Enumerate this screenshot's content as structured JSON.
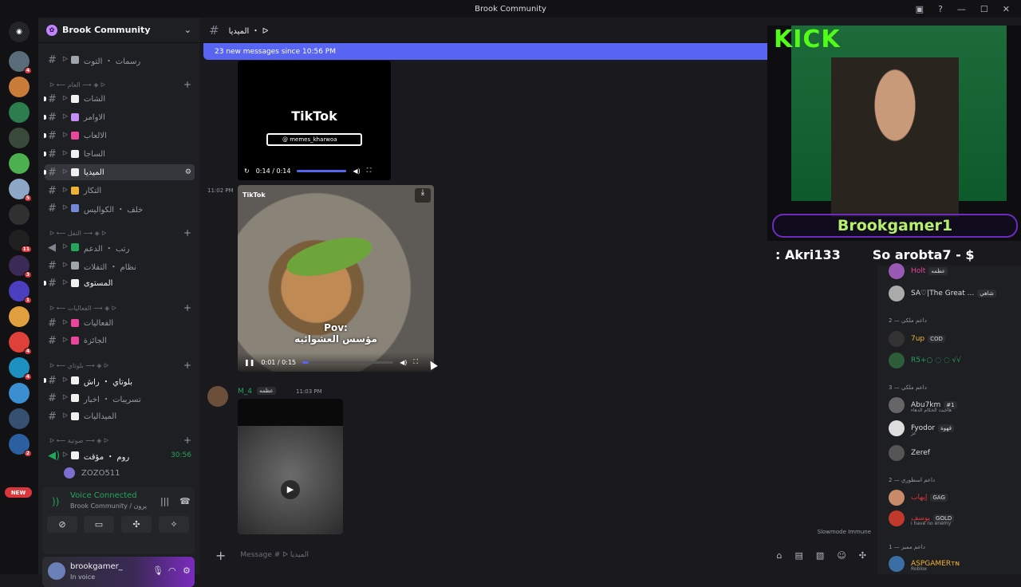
{
  "window": {
    "title": "Brook Community"
  },
  "guild": {
    "name": "Brook Community"
  },
  "categories": [
    {
      "label": "ᐅ ⟵ العام ⟶ ◈ ᐅ"
    },
    {
      "label": "ᐅ ⟵ التفل ⟶ ◈ ᐅ"
    },
    {
      "label": "ᐅ ⟵ الفعاليات ⟶ ◈ ᐅ"
    },
    {
      "label": "ᐅ ⟵ بلوتاي ⟶ ◈ ᐅ"
    },
    {
      "label": "ᐅ ⟵ صوتية ⟶ ◈ ᐅ"
    }
  ],
  "channels": [
    {
      "label": "رسمات ・ التوت",
      "color": "#a0a4ab"
    },
    {
      "label": "الشات",
      "color": "#f0f0f0"
    },
    {
      "label": "الاوامر",
      "color": "#c78ef7"
    },
    {
      "label": "الالعاب",
      "color": "#eb459e"
    },
    {
      "label": "الساجا",
      "color": "#f0f0f0"
    },
    {
      "label": "الميديا",
      "color": "#f0f0f0"
    },
    {
      "label": "التكار",
      "color": "#f0b232"
    },
    {
      "label": "خلف ・ الكواليس",
      "color": "#7289da"
    },
    {
      "label": "رتب ・ الدعم",
      "color": "#23a55a"
    },
    {
      "label": "نظام ・ التفلات",
      "color": "#a0a4ab"
    },
    {
      "label": "المستوى",
      "color": "#f0f0f0"
    },
    {
      "label": "الفعاليات",
      "color": "#eb459e"
    },
    {
      "label": "الجائزة",
      "color": "#eb459e"
    },
    {
      "label": "بلوتاي ・ راش",
      "color": "#f0f0f0"
    },
    {
      "label": "تسريبات ・ اخبار",
      "color": "#f0f0f0"
    },
    {
      "label": "الميداليات",
      "color": "#f0f0f0"
    },
    {
      "label": "روم ・ مؤقت",
      "color": "#f0f0f0",
      "timer": "30:56"
    }
  ],
  "voice_user": "ZOZO511",
  "voice_panel": {
    "status": "Voice Connected",
    "channel": "Brook Community / يرون"
  },
  "user": {
    "name": "brookgamer_",
    "status": "In voice"
  },
  "chat": {
    "channel_name": "الميديا ・ ᐅ",
    "new_messages": "23 new messages since 10:56 PM",
    "video1": {
      "time": "0:14 / 0:14",
      "brand": "TikTok",
      "search": "@ memes_kharwoa",
      "progress": 1.0
    },
    "msg1_time": "11:02 PM",
    "video2": {
      "time": "0:01 / 0:15",
      "overlay": "Pov:",
      "overlay2": "مؤسس العشوائيه",
      "watermark": "TikTok",
      "progress": 0.07
    },
    "msg2": {
      "author": "M_4",
      "tag": "عظمه",
      "time": "11:03 PM"
    },
    "slowmode": "Slowmode Immune",
    "composer_placeholder": "Message # ᐅ الميديا"
  },
  "stream": {
    "kick": "KICK",
    "streamer": "Brookgamer1",
    "ticker1": ": Akri133",
    "ticker2": "So arobta7 - $"
  },
  "members": {
    "top": [
      {
        "name": "Holt",
        "tag": "عظمه",
        "color": "#eb459e"
      },
      {
        "name": "SA♡|The Great ...",
        "tag": "شاهي",
        "color": "#dbdee1"
      }
    ],
    "cat2": "داعم ملكي — 2",
    "cat2_list": [
      {
        "name": "7up",
        "tag": "COD",
        "color": "#f0b232"
      },
      {
        "name": "R5+○ ◌ ◌ √√",
        "tag": "",
        "color": "#23a55a"
      }
    ],
    "cat3": "داعم ملكي — 3",
    "cat3_list": [
      {
        "name": "Abu7km",
        "tag": "#1",
        "color": "#dbdee1",
        "sub": "هاجيت الحكام الدهاء"
      },
      {
        "name": "Fyodor",
        "tag": "قهوة",
        "color": "#dbdee1",
        "sub": "عز"
      },
      {
        "name": "Zeref",
        "tag": "",
        "color": "#dbdee1"
      }
    ],
    "cat4": "داعم اسطوري — 2",
    "cat4_list": [
      {
        "name": "إيهاب",
        "tag": "GAG",
        "color": "#da373c"
      },
      {
        "name": "يوسف",
        "tag": "GOLD",
        "color": "#da373c",
        "sub": "i have no enemy"
      }
    ],
    "cat5": "داعم مميز — 1",
    "cat5_list": [
      {
        "name": "ASPGAMERᴛɴ",
        "tag": "",
        "color": "#f0b232",
        "sub": "Roblox"
      }
    ]
  }
}
